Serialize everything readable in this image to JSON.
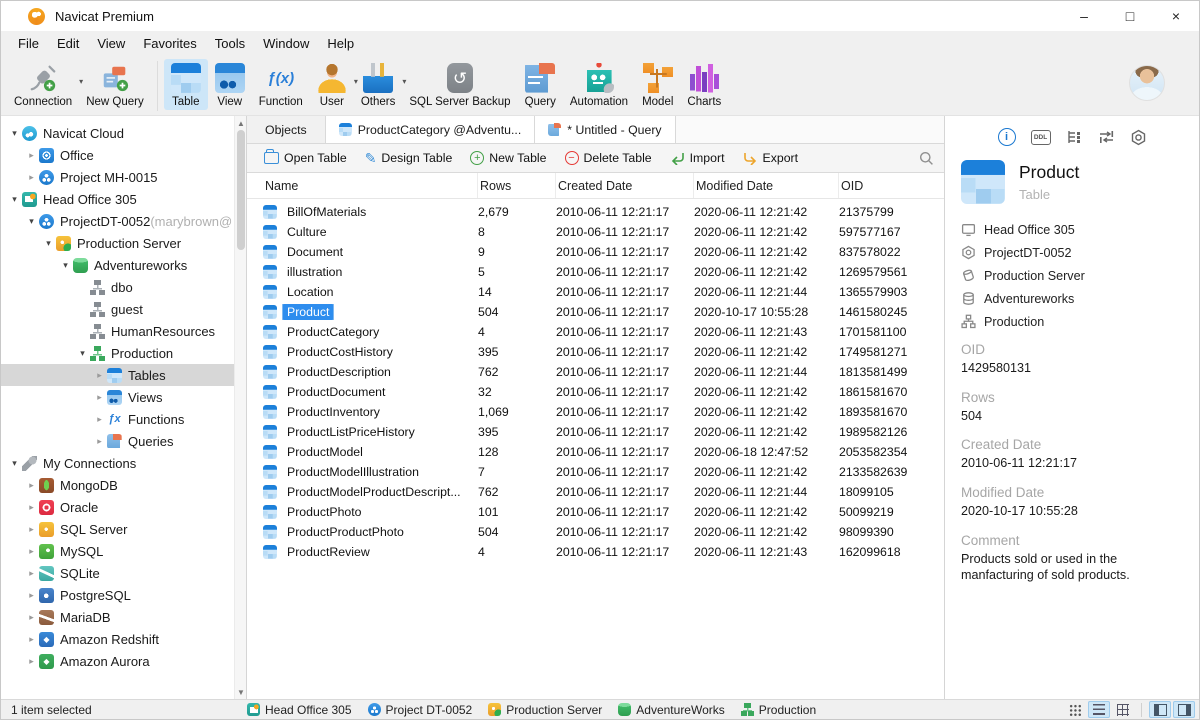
{
  "window": {
    "title": "Navicat Premium"
  },
  "menu": {
    "items": [
      "File",
      "Edit",
      "View",
      "Favorites",
      "Tools",
      "Window",
      "Help"
    ]
  },
  "toolbar": {
    "buttons": [
      {
        "label": "Connection",
        "icon": "connection-icon",
        "arrow": true
      },
      {
        "label": "New Query",
        "icon": "new-query-icon"
      },
      {
        "label": "Table",
        "icon": "table-icon",
        "active": true
      },
      {
        "label": "View",
        "icon": "view-icon"
      },
      {
        "label": "Function",
        "icon": "function-icon"
      },
      {
        "label": "User",
        "icon": "user-icon",
        "arrow": true
      },
      {
        "label": "Others",
        "icon": "others-icon",
        "arrow": true
      },
      {
        "label": "SQL Server Backup",
        "icon": "backup-icon"
      },
      {
        "label": "Query",
        "icon": "query-icon"
      },
      {
        "label": "Automation",
        "icon": "automation-icon"
      },
      {
        "label": "Model",
        "icon": "model-icon"
      },
      {
        "label": "Charts",
        "icon": "charts-icon"
      }
    ]
  },
  "sidebar": {
    "items": [
      {
        "label": "Navicat Cloud",
        "icon": "ic-cloud",
        "level": 0,
        "chevron": "chev-down"
      },
      {
        "label": "Office",
        "icon": "ic-office",
        "level": 1,
        "chevron": "chev-right"
      },
      {
        "label": "Project MH-0015",
        "icon": "ic-project",
        "level": 1,
        "chevron": "chev-right"
      },
      {
        "label": "Head Office 305",
        "icon": "ic-headoffice",
        "level": 0,
        "chevron": "chev-down"
      },
      {
        "label": "ProjectDT-0052",
        "suffix": " (marybrown@",
        "icon": "ic-project",
        "level": 1,
        "chevron": "chev-down"
      },
      {
        "label": "Production Server",
        "icon": "ic-prodserver",
        "level": 2,
        "chevron": "chev-down"
      },
      {
        "label": "Adventureworks",
        "icon": "ic-dbgreen",
        "level": 3,
        "chevron": "chev-down"
      },
      {
        "label": "dbo",
        "icon": "ic-schema",
        "level": 4,
        "chevron": "chev-none"
      },
      {
        "label": "guest",
        "icon": "ic-schema",
        "level": 4,
        "chevron": "chev-none"
      },
      {
        "label": "HumanResources",
        "icon": "ic-schema",
        "level": 4,
        "chevron": "chev-none"
      },
      {
        "label": "Production",
        "icon": "ic-schema-green",
        "level": 4,
        "chevron": "chev-down"
      },
      {
        "label": "Tables",
        "icon": "ic-table-sm",
        "level": 5,
        "chevron": "chev-right",
        "state": "selected"
      },
      {
        "label": "Views",
        "icon": "ic-view-sm",
        "level": 5,
        "chevron": "chev-right"
      },
      {
        "label": "Functions",
        "icon": "ic-fx",
        "level": 5,
        "chevron": "chev-right"
      },
      {
        "label": "Queries",
        "icon": "ic-query-sm",
        "level": 5,
        "chevron": "chev-right"
      },
      {
        "label": "My Connections",
        "icon": "ic-plug",
        "level": 0,
        "chevron": "chev-down"
      },
      {
        "label": "MongoDB",
        "icon": "ic-mongodb",
        "level": 1,
        "chevron": "chev-right"
      },
      {
        "label": "Oracle",
        "icon": "ic-oracle",
        "level": 1,
        "chevron": "chev-right"
      },
      {
        "label": "SQL Server",
        "icon": "ic-sqlserver",
        "level": 1,
        "chevron": "chev-right"
      },
      {
        "label": "MySQL",
        "icon": "ic-mysql",
        "level": 1,
        "chevron": "chev-right"
      },
      {
        "label": "SQLite",
        "icon": "ic-sqlite",
        "level": 1,
        "chevron": "chev-right"
      },
      {
        "label": "PostgreSQL",
        "icon": "ic-postgres",
        "level": 1,
        "chevron": "chev-right"
      },
      {
        "label": "MariaDB",
        "icon": "ic-mariadb",
        "level": 1,
        "chevron": "chev-right"
      },
      {
        "label": "Amazon Redshift",
        "icon": "ic-redshift",
        "level": 1,
        "chevron": "chev-right"
      },
      {
        "label": "Amazon Aurora",
        "icon": "ic-aurora",
        "level": 1,
        "chevron": "chev-right"
      }
    ]
  },
  "tabs": [
    {
      "label": "Objects"
    },
    {
      "label": "ProductCategory @Adventu...",
      "icon": "table-icon"
    },
    {
      "label": "* Untitled - Query",
      "icon": "query-icon"
    }
  ],
  "object_toolbar": {
    "buttons": [
      {
        "label": "Open Table",
        "icon": "folder-icon"
      },
      {
        "label": "Design Table",
        "icon": "pencil-icon"
      },
      {
        "label": "New Table",
        "icon": "plus-circle-icon"
      },
      {
        "label": "Delete Table",
        "icon": "minus-circle-icon"
      },
      {
        "label": "Import",
        "icon": "import-icon"
      },
      {
        "label": "Export",
        "icon": "export-icon"
      }
    ]
  },
  "table": {
    "columns": [
      "Name",
      "Rows",
      "Created Date",
      "Modified Date",
      "OID"
    ],
    "rows": [
      {
        "name": "BillOfMaterials",
        "rows": "2,679",
        "created": "2010-06-11 12:21:17",
        "modified": "2020-06-11 12:21:42",
        "oid": "21375799"
      },
      {
        "name": "Culture",
        "rows": "8",
        "created": "2010-06-11 12:21:17",
        "modified": "2020-06-11 12:21:42",
        "oid": "597577167"
      },
      {
        "name": "Document",
        "rows": "9",
        "created": "2010-06-11 12:21:17",
        "modified": "2020-06-11 12:21:42",
        "oid": "837578022"
      },
      {
        "name": "illustration",
        "rows": "5",
        "created": "2010-06-11 12:21:17",
        "modified": "2020-06-11 12:21:42",
        "oid": "1269579561"
      },
      {
        "name": "Location",
        "rows": "14",
        "created": "2010-06-11 12:21:17",
        "modified": "2020-06-11 12:21:44",
        "oid": "1365579903"
      },
      {
        "name": "Product",
        "rows": "504",
        "created": "2010-06-11 12:21:17",
        "modified": "2020-10-17 10:55:28",
        "oid": "1461580245",
        "state": "selected"
      },
      {
        "name": "ProductCategory",
        "rows": "4",
        "created": "2010-06-11 12:21:17",
        "modified": "2020-06-11 12:21:43",
        "oid": "1701581100"
      },
      {
        "name": "ProductCostHistory",
        "rows": "395",
        "created": "2010-06-11 12:21:17",
        "modified": "2020-06-11 12:21:42",
        "oid": "1749581271"
      },
      {
        "name": "ProductDescription",
        "rows": "762",
        "created": "2010-06-11 12:21:17",
        "modified": "2020-06-11 12:21:44",
        "oid": "1813581499"
      },
      {
        "name": "ProductDocument",
        "rows": "32",
        "created": "2010-06-11 12:21:17",
        "modified": "2020-06-11 12:21:42",
        "oid": "1861581670"
      },
      {
        "name": "ProductInventory",
        "rows": "1,069",
        "created": "2010-06-11 12:21:17",
        "modified": "2020-06-11 12:21:42",
        "oid": "1893581670"
      },
      {
        "name": "ProductListPriceHistory",
        "rows": "395",
        "created": "2010-06-11 12:21:17",
        "modified": "2020-06-11 12:21:42",
        "oid": "1989582126"
      },
      {
        "name": "ProductModel",
        "rows": "128",
        "created": "2010-06-11 12:21:17",
        "modified": "2020-06-18 12:47:52",
        "oid": "2053582354"
      },
      {
        "name": "ProductModelIllustration",
        "rows": "7",
        "created": "2010-06-11 12:21:17",
        "modified": "2020-06-11 12:21:42",
        "oid": "2133582639"
      },
      {
        "name": "ProductModelProductDescript...",
        "rows": "762",
        "created": "2010-06-11 12:21:17",
        "modified": "2020-06-11 12:21:44",
        "oid": "18099105"
      },
      {
        "name": "ProductPhoto",
        "rows": "101",
        "created": "2010-06-11 12:21:17",
        "modified": "2020-06-11 12:21:42",
        "oid": "50099219"
      },
      {
        "name": "ProductProductPhoto",
        "rows": "504",
        "created": "2010-06-11 12:21:17",
        "modified": "2020-06-11 12:21:42",
        "oid": "98099390"
      },
      {
        "name": "ProductReview",
        "rows": "4",
        "created": "2010-06-11 12:21:17",
        "modified": "2020-06-11 12:21:43",
        "oid": "162099618"
      }
    ]
  },
  "right_panel": {
    "icons": [
      "info-icon",
      "ddl-icon",
      "structure-icon",
      "relation-icon",
      "hexnut-icon"
    ],
    "title": "Product",
    "subtitle": "Table",
    "crumbs": [
      {
        "label": "Head Office 305",
        "icon": "monitor-icon"
      },
      {
        "label": "ProjectDT-0052",
        "icon": "hexagon-icon"
      },
      {
        "label": "Production Server",
        "icon": "server-icon"
      },
      {
        "label": "Adventureworks",
        "icon": "database-icon"
      },
      {
        "label": "Production",
        "icon": "sitemap-icon"
      }
    ],
    "fields": [
      {
        "label": "OID",
        "value": "1429580131"
      },
      {
        "label": "Rows",
        "value": "504"
      },
      {
        "label": "Created Date",
        "value": "2010-06-11 12:21:17"
      },
      {
        "label": "Modified Date",
        "value": "2020-10-17 10:55:28"
      },
      {
        "label": "Comment",
        "value": "Products sold or used in the manfacturing of sold products."
      }
    ]
  },
  "status_bar": {
    "selection": "1 item selected",
    "path": [
      {
        "label": "Head Office 305",
        "icon": "ic-headoffice"
      },
      {
        "label": "Project DT-0052",
        "icon": "ic-project"
      },
      {
        "label": "Production Server",
        "icon": "ic-prodserver"
      },
      {
        "label": "AdventureWorks",
        "icon": "ic-dbgreen"
      },
      {
        "label": "Production",
        "icon": "ic-schema-green"
      }
    ]
  },
  "colors": {
    "accent": "#2e8dee",
    "toolbar_active": "#cde6f8",
    "tree_selected": "#d7d7d7"
  }
}
